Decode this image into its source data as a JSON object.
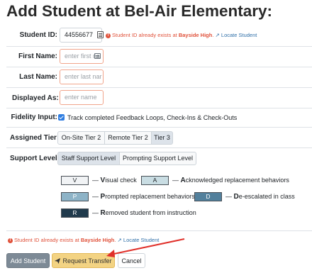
{
  "page": {
    "title": "Add Student at Bel-Air Elementary:"
  },
  "fields": {
    "student_id": {
      "label": "Student ID:",
      "value": "44556677"
    },
    "first_name": {
      "label": "First Name:",
      "placeholder": "enter first na"
    },
    "last_name": {
      "label": "Last Name:",
      "placeholder": "enter last nar"
    },
    "displayed_as": {
      "label": "Displayed As:",
      "placeholder": "enter name"
    }
  },
  "error": {
    "icon": "!",
    "prefix": "Student ID already exists at",
    "school": "Bayside High",
    "period": ".",
    "link_icon": "↗",
    "link_label": "Locate Student"
  },
  "fidelity": {
    "label": "Fidelity Input:",
    "checked": true,
    "text": "Track completed Feedback Loops, Check-Ins & Check-Outs"
  },
  "tier": {
    "label": "Assigned Tier:",
    "options": [
      "On-Site Tier 2",
      "Remote Tier 2",
      "Tier 3"
    ],
    "selected": "Tier 3"
  },
  "support": {
    "label": "Support Level:",
    "options": [
      "Staff Support Level",
      "Prompting Support Level"
    ],
    "selected": "Staff Support Level"
  },
  "legend": [
    {
      "code": "V",
      "initial": "V",
      "rest": "isual check",
      "color": "#f1f3f5",
      "text_color": "#212529"
    },
    {
      "code": "A",
      "initial": "A",
      "rest": "cknowledged replacement behaviors",
      "color": "#c9dde3",
      "text_color": "#212529"
    },
    {
      "code": "P",
      "initial": "P",
      "rest": "rompted replacement behaviors",
      "color": "#8db3c7",
      "text_color": "#ffffff"
    },
    {
      "code": "D",
      "initial": "D",
      "rest": "e-escalated in class",
      "color": "#52809c",
      "text_color": "#ffffff"
    },
    {
      "code": "R",
      "initial": "R",
      "rest": "emoved student from instruction",
      "color": "#203a4c",
      "text_color": "#ffffff"
    }
  ],
  "legend_dash": "—",
  "buttons": {
    "add": "Add Student",
    "transfer": "Request Transfer",
    "cancel": "Cancel"
  },
  "colors": {
    "error": "#e0513a",
    "link": "#2f6fa8",
    "annotation_arrow": "#e0302a",
    "transfer_button": "#f3d383"
  }
}
